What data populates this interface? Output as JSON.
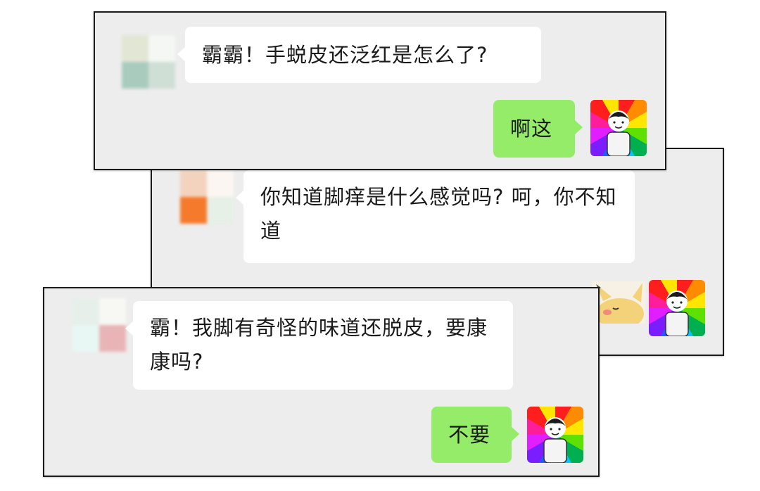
{
  "cards": [
    {
      "messages": [
        {
          "side": "incoming",
          "text": "霸霸！手蜕皮还泛红是怎么了?"
        },
        {
          "side": "outgoing",
          "text": "啊这"
        }
      ]
    },
    {
      "messages": [
        {
          "side": "incoming",
          "text": "你知道脚痒是什么感觉吗? 呵，你不知道"
        }
      ]
    },
    {
      "messages": [
        {
          "side": "incoming",
          "text": "霸！我脚有奇怪的味道还脱皮，要康康吗?"
        },
        {
          "side": "outgoing",
          "text": "不要"
        }
      ]
    }
  ],
  "colors": {
    "card_background": "#ededed",
    "incoming_bubble": "#ffffff",
    "outgoing_bubble": "#95ec69"
  },
  "icons": {
    "sender_avatar": "blurred-mosaic-avatar-icon",
    "self_avatar": "rainbow-boy-avatar-icon",
    "cat_avatar": "cat-sticker-avatar-icon"
  }
}
